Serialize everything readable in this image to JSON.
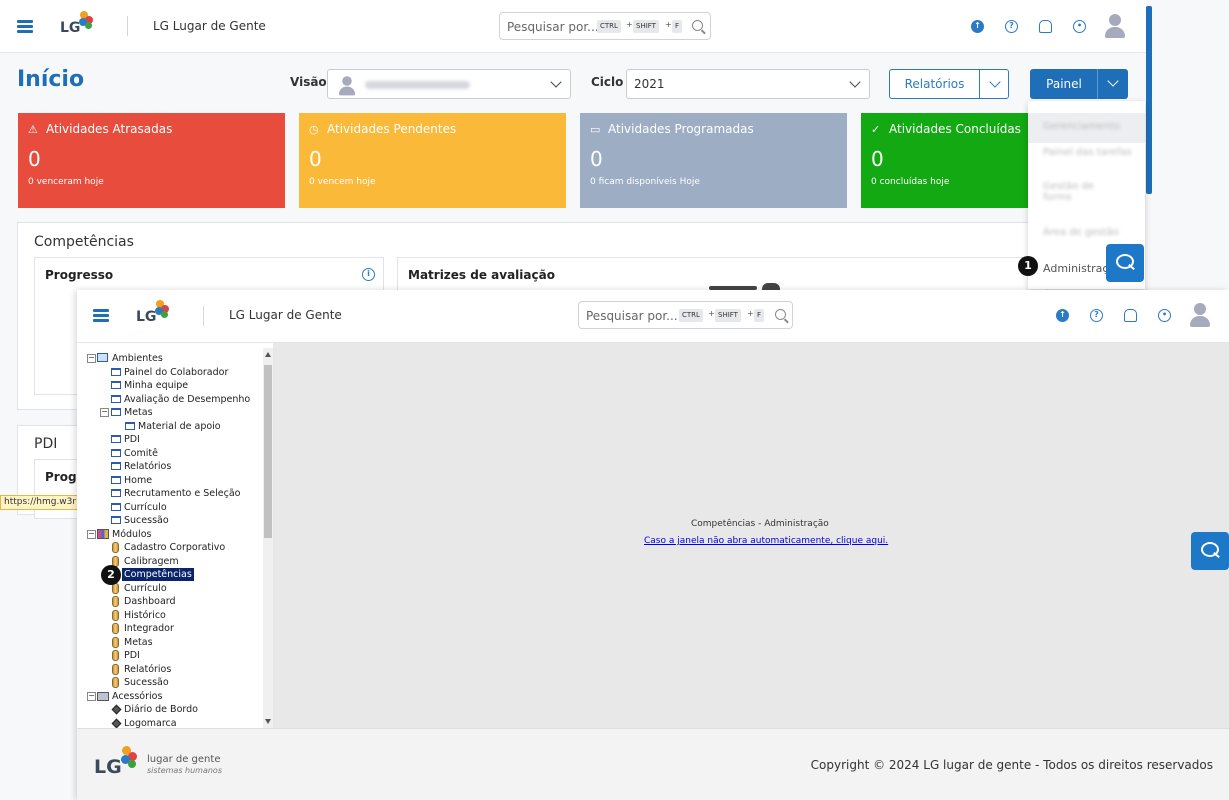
{
  "app": {
    "brand": "LG Lugar de Gente",
    "search_placeholder": "Pesquisar por...",
    "shortcut_keys": [
      "CTRL",
      "SHIFT",
      "F"
    ]
  },
  "main": {
    "title": "Início",
    "visao_label": "Visão",
    "ciclo_label": "Ciclo",
    "ciclo_value": "2021",
    "relatorios_button": "Relatórios",
    "painel_button": "Painel"
  },
  "cards": [
    {
      "title": "Atividades Atrasadas",
      "count": "0",
      "sub": "0 venceram hoje",
      "color": "#e74c3c",
      "icon": "warning-icon"
    },
    {
      "title": "Atividades Pendentes",
      "count": "0",
      "sub": "0 vencem hoje",
      "color": "#fbb93a",
      "icon": "clock-icon"
    },
    {
      "title": "Atividades Programadas",
      "count": "0",
      "sub": "0 ficam disponíveis Hoje",
      "color": "#9daec4",
      "icon": "folder-icon"
    },
    {
      "title": "Atividades Concluídas",
      "count": "0",
      "sub": "0 concluídas hoje",
      "color": "#12a912",
      "icon": "check-icon"
    }
  ],
  "competencias": {
    "title": "Competências",
    "progresso": "Progresso",
    "matrizes": "Matrizes de avaliação"
  },
  "pdi": {
    "title": "PDI",
    "progress_partial": "Progr"
  },
  "dropdown": {
    "admin_item": "Administração"
  },
  "badges": [
    "1",
    "2"
  ],
  "url_tooltip": "https://hmg.w3r",
  "tree": {
    "items": [
      {
        "label": "Ambientes"
      },
      {
        "label": "Painel do Colaborador"
      },
      {
        "label": "Minha equipe"
      },
      {
        "label": "Avaliação de Desempenho"
      },
      {
        "label": "Metas"
      },
      {
        "label": "Material de apoio"
      },
      {
        "label": "PDI"
      },
      {
        "label": "Comitê"
      },
      {
        "label": "Relatórios"
      },
      {
        "label": "Home"
      },
      {
        "label": "Recrutamento e Seleção"
      },
      {
        "label": "Currículo"
      },
      {
        "label": "Sucessão"
      },
      {
        "label": "Módulos"
      },
      {
        "label": "Cadastro Corporativo"
      },
      {
        "label": "Calibragem"
      },
      {
        "label": "Competências"
      },
      {
        "label": "Currículo"
      },
      {
        "label": "Dashboard"
      },
      {
        "label": "Histórico"
      },
      {
        "label": "Integrador"
      },
      {
        "label": "Metas"
      },
      {
        "label": "PDI"
      },
      {
        "label": "Relatórios"
      },
      {
        "label": "Sucessão"
      },
      {
        "label": "Acessórios"
      },
      {
        "label": "Diário de Bordo"
      },
      {
        "label": "Logomarca"
      }
    ]
  },
  "content": {
    "title": "Competências - Administração",
    "link": "Caso a janela não abra automaticamente, clique aqui."
  },
  "footer": {
    "brand_line1": "lugar de gente",
    "brand_line2": "sistemas humanos",
    "copyright": "Copyright © 2024 LG lugar de gente - Todos os direitos reservados"
  },
  "colors": {
    "primary": "#1e6fb8",
    "chat": "#1e78c8"
  }
}
